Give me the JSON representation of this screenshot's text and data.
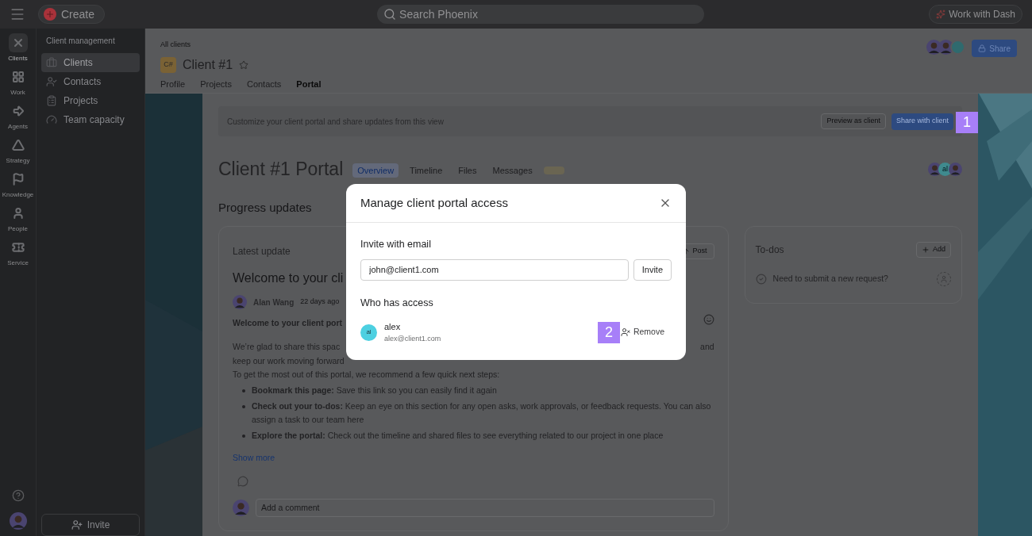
{
  "topbar": {
    "create": "Create",
    "search_placeholder": "Search Phoenix",
    "work_with": "Work with Dash"
  },
  "rail": [
    {
      "label": "Clients",
      "kind": "clients",
      "selected": true
    },
    {
      "label": "Work",
      "kind": "work",
      "selected": false
    },
    {
      "label": "Agents",
      "kind": "agents",
      "selected": false
    },
    {
      "label": "Strategy",
      "kind": "strategy",
      "selected": false
    },
    {
      "label": "Knowledge",
      "kind": "knowledge",
      "selected": false
    },
    {
      "label": "People",
      "kind": "people",
      "selected": false
    },
    {
      "label": "Service",
      "kind": "service",
      "selected": false
    }
  ],
  "sidebar": {
    "heading": "Client management",
    "items": [
      {
        "label": "Clients",
        "kind": "briefcase",
        "selected": true
      },
      {
        "label": "Contacts",
        "kind": "contact",
        "selected": false
      },
      {
        "label": "Projects",
        "kind": "clipboard",
        "selected": false
      },
      {
        "label": "Team capacity",
        "kind": "gauge",
        "selected": false
      }
    ],
    "invite": "Invite"
  },
  "header": {
    "breadcrumb": "All clients",
    "badge": "C#",
    "title": "Client #1",
    "share": "Share",
    "tabs": [
      {
        "label": "Profile",
        "selected": false
      },
      {
        "label": "Projects",
        "selected": false
      },
      {
        "label": "Contacts",
        "selected": false
      },
      {
        "label": "Portal",
        "selected": true
      }
    ]
  },
  "banner": {
    "text": "Customize your client portal and share updates from this view",
    "preview": "Preview as client",
    "share": "Share with client",
    "marker": "1"
  },
  "portal": {
    "title": "Client #1 Portal",
    "member_initials": "al",
    "tabs": [
      {
        "label": "Overview",
        "selected": true
      },
      {
        "label": "Timeline",
        "selected": false
      },
      {
        "label": "Files",
        "selected": false
      },
      {
        "label": "Messages",
        "selected": false
      }
    ]
  },
  "progress": {
    "heading": "Progress updates",
    "card": {
      "label": "Latest update",
      "post": "Post",
      "title": "Welcome to your cli",
      "author": "Alan Wang",
      "time": "22 days ago",
      "lead": "Welcome to your client port",
      "para_start": "We’re glad to share this spac",
      "para_end": "and",
      "para_next": "keep our work moving forward",
      "intro": "To get the most out of this portal, we recommend a few quick next steps:",
      "bullets": [
        "**Bookmark this page:** Save this link so you can easily find it again",
        "**Check out your to-dos:** Keep an eye on this section for any open asks, work approvals, or feedback requests. You can also assign a task to our team here",
        "**Explore the portal:** Check out the timeline and shared files to see everything related to our project in one place"
      ],
      "show_more": "Show more",
      "comment_placeholder": "Add a comment"
    }
  },
  "todos": {
    "title": "To-dos",
    "add": "Add",
    "items": [
      {
        "text": "Need to submit a new request?"
      }
    ]
  },
  "modal": {
    "title": "Manage client portal access",
    "invite_label": "Invite with email",
    "email": "john@client1.com",
    "invite": "Invite",
    "access_label": "Who has access",
    "members": [
      {
        "initials": "al",
        "name": "alex",
        "email": "alex@client1.com",
        "remove": "Remove",
        "marker": "2"
      }
    ]
  }
}
